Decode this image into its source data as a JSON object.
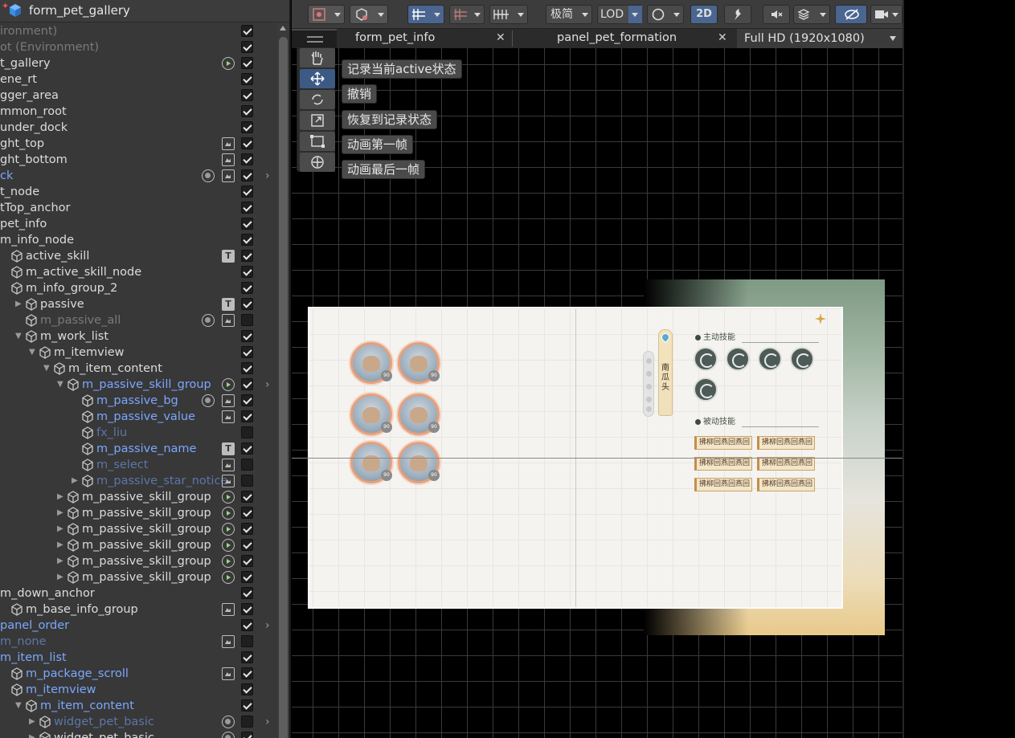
{
  "hierarchy": {
    "title": "form_pet_gallery",
    "rows": [
      {
        "label": "ironment)",
        "style": "gray",
        "indent": 0,
        "cube": false,
        "arrow": "",
        "icon": "",
        "icon2": "",
        "check": true,
        "chevron": false
      },
      {
        "label": "ot (Environment)",
        "style": "gray",
        "indent": 0,
        "cube": false,
        "arrow": "",
        "icon": "",
        "icon2": "",
        "check": true,
        "chevron": false
      },
      {
        "label": "t_gallery",
        "style": "",
        "indent": 0,
        "cube": false,
        "arrow": "",
        "icon": "play",
        "icon2": "",
        "check": true,
        "chevron": false
      },
      {
        "label": "ene_rt",
        "style": "",
        "indent": 0,
        "cube": false,
        "arrow": "",
        "icon": "",
        "icon2": "",
        "check": true,
        "chevron": false
      },
      {
        "label": "gger_area",
        "style": "",
        "indent": 0,
        "cube": false,
        "arrow": "",
        "icon": "",
        "icon2": "",
        "check": true,
        "chevron": false
      },
      {
        "label": "mmon_root",
        "style": "",
        "indent": 0,
        "cube": false,
        "arrow": "",
        "icon": "",
        "icon2": "",
        "check": true,
        "chevron": false
      },
      {
        "label": "under_dock",
        "style": "",
        "indent": 0,
        "cube": false,
        "arrow": "",
        "icon": "",
        "icon2": "",
        "check": true,
        "chevron": false
      },
      {
        "label": "ght_top",
        "style": "",
        "indent": 0,
        "cube": false,
        "arrow": "",
        "icon": "img",
        "icon2": "",
        "check": true,
        "chevron": false
      },
      {
        "label": "ght_bottom",
        "style": "",
        "indent": 0,
        "cube": false,
        "arrow": "",
        "icon": "img",
        "icon2": "",
        "check": true,
        "chevron": false
      },
      {
        "label": "ck",
        "style": "blue",
        "indent": 0,
        "cube": false,
        "arrow": "",
        "icon": "img",
        "icon2": "dot",
        "check": true,
        "chevron": true
      },
      {
        "label": "t_node",
        "style": "",
        "indent": 0,
        "cube": false,
        "arrow": "",
        "icon": "",
        "icon2": "",
        "check": true,
        "chevron": false
      },
      {
        "label": "tTop_anchor",
        "style": "",
        "indent": 0,
        "cube": false,
        "arrow": "",
        "icon": "",
        "icon2": "",
        "check": true,
        "chevron": false
      },
      {
        "label": "pet_info",
        "style": "",
        "indent": 0,
        "cube": false,
        "arrow": "",
        "icon": "",
        "icon2": "",
        "check": true,
        "chevron": false
      },
      {
        "label": "m_info_node",
        "style": "",
        "indent": 0,
        "cube": false,
        "arrow": "",
        "icon": "",
        "icon2": "",
        "check": true,
        "chevron": false
      },
      {
        "label": "active_skill",
        "style": "",
        "indent": 15,
        "cube": true,
        "arrow": "",
        "icon": "txt",
        "icon2": "",
        "check": true,
        "chevron": false
      },
      {
        "label": "m_active_skill_node",
        "style": "",
        "indent": 15,
        "cube": true,
        "arrow": "",
        "icon": "",
        "icon2": "",
        "check": true,
        "chevron": false
      },
      {
        "label": "m_info_group_2",
        "style": "",
        "indent": 15,
        "cube": true,
        "arrow": "",
        "icon": "",
        "icon2": "",
        "check": true,
        "chevron": false
      },
      {
        "label": "passive",
        "style": "",
        "indent": 33,
        "cube": true,
        "arrow": "right",
        "icon": "txt",
        "icon2": "",
        "check": true,
        "chevron": false
      },
      {
        "label": "m_passive_all",
        "style": "gray",
        "indent": 33,
        "cube": true,
        "arrow": "",
        "icon": "img",
        "icon2": "dot",
        "check": false,
        "chevron": false
      },
      {
        "label": "m_work_list",
        "style": "",
        "indent": 33,
        "cube": true,
        "arrow": "down",
        "icon": "",
        "icon2": "",
        "check": true,
        "chevron": false
      },
      {
        "label": "m_itemview",
        "style": "",
        "indent": 50,
        "cube": true,
        "arrow": "down",
        "icon": "",
        "icon2": "",
        "check": true,
        "chevron": false
      },
      {
        "label": "m_item_content",
        "style": "",
        "indent": 68,
        "cube": true,
        "arrow": "down",
        "icon": "",
        "icon2": "",
        "check": true,
        "chevron": false
      },
      {
        "label": "m_passive_skill_group",
        "style": "blue",
        "indent": 85,
        "cube": true,
        "arrow": "down",
        "icon": "play",
        "icon2": "",
        "check": true,
        "chevron": true
      },
      {
        "label": "m_passive_bg",
        "style": "blue",
        "indent": 103,
        "cube": true,
        "arrow": "",
        "icon": "img",
        "icon2": "dot",
        "check": true,
        "chevron": false
      },
      {
        "label": "m_passive_value",
        "style": "blue",
        "indent": 103,
        "cube": true,
        "arrow": "",
        "icon": "img",
        "icon2": "",
        "check": true,
        "chevron": false
      },
      {
        "label": "fx_liu",
        "style": "bluegray",
        "indent": 103,
        "cube": true,
        "arrow": "",
        "icon": "",
        "icon2": "",
        "check": false,
        "chevron": false
      },
      {
        "label": "m_passive_name",
        "style": "blue",
        "indent": 103,
        "cube": true,
        "arrow": "",
        "icon": "txt",
        "icon2": "",
        "check": true,
        "chevron": false
      },
      {
        "label": "m_select",
        "style": "bluegray",
        "indent": 103,
        "cube": true,
        "arrow": "",
        "icon": "img",
        "icon2": "",
        "check": false,
        "chevron": false
      },
      {
        "label": "m_passive_star_notice",
        "style": "bluegray",
        "indent": 103,
        "cube": true,
        "arrow": "right",
        "icon": "img",
        "icon2": "",
        "check": false,
        "chevron": false
      },
      {
        "label": "m_passive_skill_group",
        "style": "",
        "indent": 85,
        "cube": true,
        "arrow": "right",
        "icon": "play",
        "icon2": "",
        "check": true,
        "chevron": false
      },
      {
        "label": "m_passive_skill_group",
        "style": "",
        "indent": 85,
        "cube": true,
        "arrow": "right",
        "icon": "play",
        "icon2": "",
        "check": true,
        "chevron": false
      },
      {
        "label": "m_passive_skill_group",
        "style": "",
        "indent": 85,
        "cube": true,
        "arrow": "right",
        "icon": "play",
        "icon2": "",
        "check": true,
        "chevron": false
      },
      {
        "label": "m_passive_skill_group",
        "style": "",
        "indent": 85,
        "cube": true,
        "arrow": "right",
        "icon": "play",
        "icon2": "",
        "check": true,
        "chevron": false
      },
      {
        "label": "m_passive_skill_group",
        "style": "",
        "indent": 85,
        "cube": true,
        "arrow": "right",
        "icon": "play",
        "icon2": "",
        "check": true,
        "chevron": false
      },
      {
        "label": "m_passive_skill_group",
        "style": "",
        "indent": 85,
        "cube": true,
        "arrow": "right",
        "icon": "play",
        "icon2": "",
        "check": true,
        "chevron": false
      },
      {
        "label": "m_down_anchor",
        "style": "",
        "indent": 0,
        "cube": false,
        "arrow": "",
        "icon": "",
        "icon2": "",
        "check": true,
        "chevron": false
      },
      {
        "label": "m_base_info_group",
        "style": "",
        "indent": 15,
        "cube": true,
        "arrow": "",
        "icon": "img",
        "icon2": "",
        "check": true,
        "chevron": false
      },
      {
        "label": "panel_order",
        "style": "blue",
        "indent": 0,
        "cube": false,
        "arrow": "",
        "icon": "",
        "icon2": "",
        "check": true,
        "chevron": true
      },
      {
        "label": "m_none",
        "style": "bluegray",
        "indent": 0,
        "cube": false,
        "arrow": "",
        "icon": "img",
        "icon2": "",
        "check": false,
        "chevron": false
      },
      {
        "label": "m_item_list",
        "style": "blue",
        "indent": 0,
        "cube": false,
        "arrow": "",
        "icon": "",
        "icon2": "",
        "check": true,
        "chevron": false
      },
      {
        "label": "m_package_scroll",
        "style": "blue",
        "indent": 15,
        "cube": true,
        "arrow": "",
        "icon": "img",
        "icon2": "",
        "check": true,
        "chevron": false
      },
      {
        "label": "m_itemview",
        "style": "blue",
        "indent": 15,
        "cube": true,
        "arrow": "",
        "icon": "",
        "icon2": "",
        "check": true,
        "chevron": false
      },
      {
        "label": "m_item_content",
        "style": "blue",
        "indent": 33,
        "cube": true,
        "arrow": "down",
        "icon": "",
        "icon2": "",
        "check": true,
        "chevron": false
      },
      {
        "label": "widget_pet_basic",
        "style": "bluegray",
        "indent": 50,
        "cube": true,
        "arrow": "right",
        "icon": "dot",
        "icon2": "",
        "check": false,
        "chevron": true
      },
      {
        "label": "widget_pet_basic",
        "style": "",
        "indent": 50,
        "cube": true,
        "arrow": "right",
        "icon": "dot",
        "icon2": "",
        "check": true,
        "chevron": false
      }
    ]
  },
  "toolbar": {
    "quality_label": "极简",
    "lod_label": "LOD",
    "mode_2d_label": "2D"
  },
  "tabs": [
    {
      "label": "form_pet_info"
    },
    {
      "label": "panel_pet_formation"
    }
  ],
  "resolution": {
    "label": "Full HD (1920x1080)"
  },
  "tool_tips": [
    {
      "label": "记录当前active状态"
    },
    {
      "label": "撤销"
    },
    {
      "label": "恢复到记录状态"
    },
    {
      "label": "动画第一帧"
    },
    {
      "label": "动画最后一帧"
    }
  ],
  "game_ui": {
    "active_title": "主动技能",
    "passive_title": "被动技能",
    "banner_text": "南瓜头",
    "passive_tags": [
      "拂柳回燕回燕回",
      "拂柳回燕回燕回",
      "拂柳回燕回燕回",
      "拂柳回燕回燕回",
      "拂柳回燕回燕回",
      "拂柳回燕回燕回"
    ],
    "avatar_level": "90"
  },
  "colors": {
    "selection_blue": "#7ba7ff",
    "active_tool": "#3d5a85",
    "panel_green": "#7e9a84",
    "panel_gold": "#e8c98a"
  }
}
